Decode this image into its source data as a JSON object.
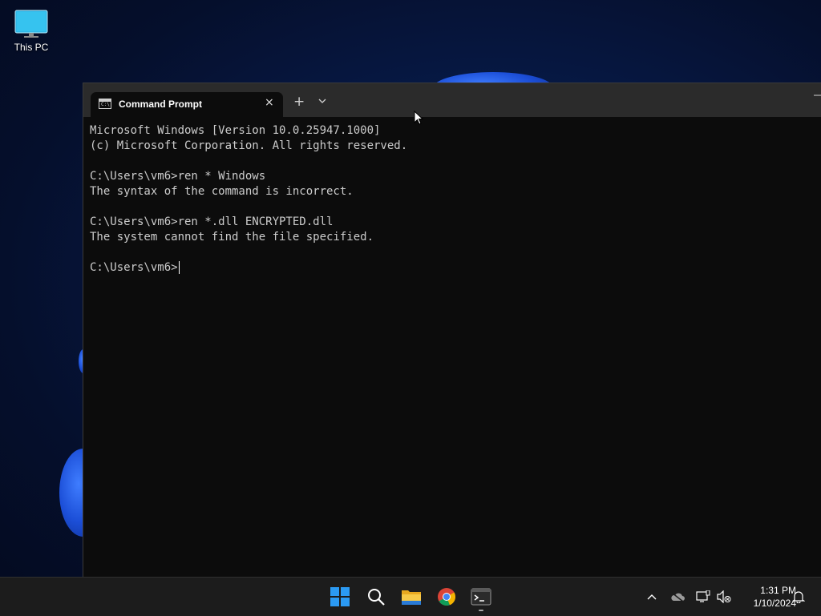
{
  "desktop": {
    "icons": [
      {
        "label": "This PC",
        "icon": "monitor-icon"
      }
    ]
  },
  "window": {
    "tab": {
      "title": "Command Prompt",
      "icon": "cmd-icon",
      "close": "×"
    },
    "new_tab": "+",
    "dropdown": "⌄",
    "minimize": "—",
    "console_lines": [
      "Microsoft Windows [Version 10.0.25947.1000]",
      "(c) Microsoft Corporation. All rights reserved.",
      "",
      "C:\\Users\\vm6>ren * Windows",
      "The syntax of the command is incorrect.",
      "",
      "C:\\Users\\vm6>ren *.dll ENCRYPTED.dll",
      "The system cannot find the file specified.",
      "",
      "C:\\Users\\vm6>"
    ]
  },
  "taskbar": {
    "apps": [
      "start-icon",
      "search-icon",
      "file-explorer-icon",
      "chrome-icon",
      "terminal-icon"
    ],
    "tray": [
      "chevron-up-icon",
      "onedrive-icon",
      "network-icon",
      "volume-muted-icon"
    ],
    "time": "1:31 PM",
    "date": "1/10/2024",
    "notifications": "bell-icon"
  },
  "colors": {
    "console_bg": "#0c0c0c",
    "console_fg": "#cccccc",
    "taskbar_bg": "#1c1c1c",
    "accent": "#0078d4"
  }
}
